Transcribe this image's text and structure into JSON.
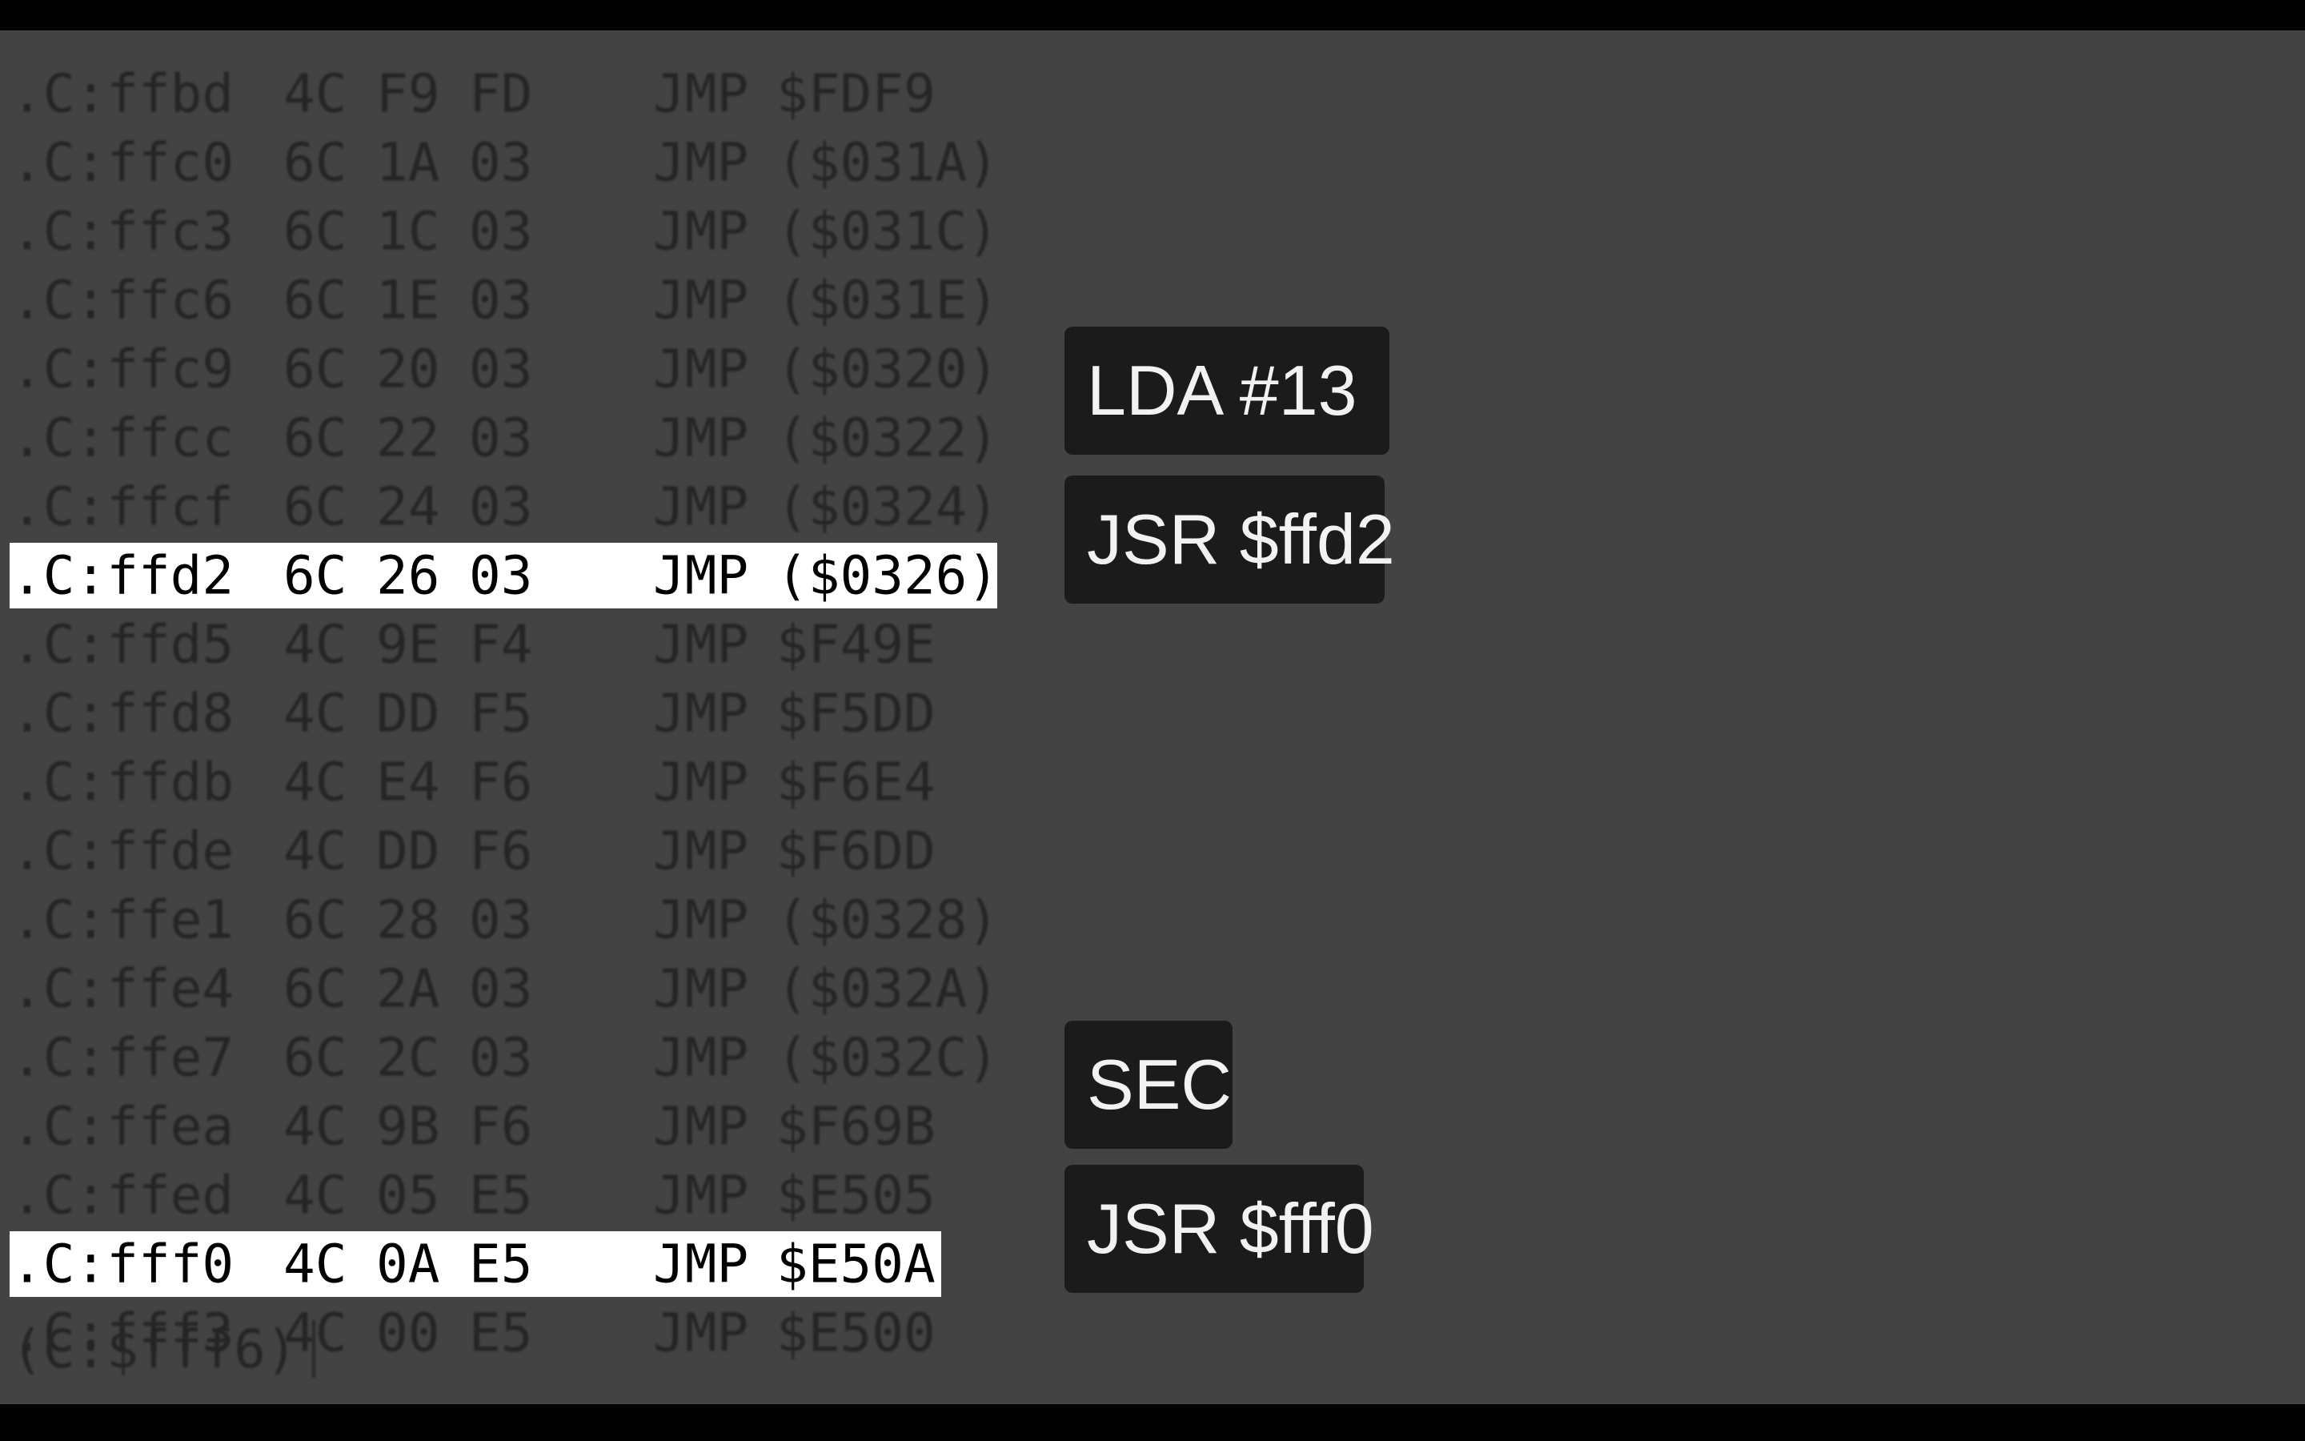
{
  "listing": {
    "rows": [
      {
        "addr": ".C:ffbd",
        "b1": "4C",
        "b2": "F9",
        "b3": "FD",
        "mnemonic": "JMP",
        "operand": "$FDF9"
      },
      {
        "addr": ".C:ffc0",
        "b1": "6C",
        "b2": "1A",
        "b3": "03",
        "mnemonic": "JMP",
        "operand": "($031A)"
      },
      {
        "addr": ".C:ffc3",
        "b1": "6C",
        "b2": "1C",
        "b3": "03",
        "mnemonic": "JMP",
        "operand": "($031C)"
      },
      {
        "addr": ".C:ffc6",
        "b1": "6C",
        "b2": "1E",
        "b3": "03",
        "mnemonic": "JMP",
        "operand": "($031E)"
      },
      {
        "addr": ".C:ffc9",
        "b1": "6C",
        "b2": "20",
        "b3": "03",
        "mnemonic": "JMP",
        "operand": "($0320)"
      },
      {
        "addr": ".C:ffcc",
        "b1": "6C",
        "b2": "22",
        "b3": "03",
        "mnemonic": "JMP",
        "operand": "($0322)"
      },
      {
        "addr": ".C:ffcf",
        "b1": "6C",
        "b2": "24",
        "b3": "03",
        "mnemonic": "JMP",
        "operand": "($0324)"
      },
      {
        "addr": ".C:ffd2",
        "b1": "6C",
        "b2": "26",
        "b3": "03",
        "mnemonic": "JMP",
        "operand": "($0326)"
      },
      {
        "addr": ".C:ffd5",
        "b1": "4C",
        "b2": "9E",
        "b3": "F4",
        "mnemonic": "JMP",
        "operand": "$F49E"
      },
      {
        "addr": ".C:ffd8",
        "b1": "4C",
        "b2": "DD",
        "b3": "F5",
        "mnemonic": "JMP",
        "operand": "$F5DD"
      },
      {
        "addr": ".C:ffdb",
        "b1": "4C",
        "b2": "E4",
        "b3": "F6",
        "mnemonic": "JMP",
        "operand": "$F6E4"
      },
      {
        "addr": ".C:ffde",
        "b1": "4C",
        "b2": "DD",
        "b3": "F6",
        "mnemonic": "JMP",
        "operand": "$F6DD"
      },
      {
        "addr": ".C:ffe1",
        "b1": "6C",
        "b2": "28",
        "b3": "03",
        "mnemonic": "JMP",
        "operand": "($0328)"
      },
      {
        "addr": ".C:ffe4",
        "b1": "6C",
        "b2": "2A",
        "b3": "03",
        "mnemonic": "JMP",
        "operand": "($032A)"
      },
      {
        "addr": ".C:ffe7",
        "b1": "6C",
        "b2": "2C",
        "b3": "03",
        "mnemonic": "JMP",
        "operand": "($032C)"
      },
      {
        "addr": ".C:ffea",
        "b1": "4C",
        "b2": "9B",
        "b3": "F6",
        "mnemonic": "JMP",
        "operand": "$F69B"
      },
      {
        "addr": ".C:ffed",
        "b1": "4C",
        "b2": "05",
        "b3": "E5",
        "mnemonic": "JMP",
        "operand": "$E505"
      },
      {
        "addr": ".C:fff0",
        "b1": "4C",
        "b2": "0A",
        "b3": "E5",
        "mnemonic": "JMP",
        "operand": "$E50A"
      },
      {
        "addr": ".C:fff3",
        "b1": "4C",
        "b2": "00",
        "b3": "E5",
        "mnemonic": "JMP",
        "operand": "$E500"
      }
    ]
  },
  "prompt": {
    "text": "(C:$fff6)"
  },
  "annotations": {
    "lda": "LDA #13",
    "jsr_ffd2": "JSR $ffd2",
    "sec": "SEC",
    "jsr_fff0": "JSR $fff0"
  },
  "colors": {
    "background": "#434343",
    "frame": "#000000",
    "dim_text": "#252525",
    "highlight_bg": "#ffffff",
    "label_bg": "#1b1b1b",
    "label_text": "#f2f2f2"
  }
}
